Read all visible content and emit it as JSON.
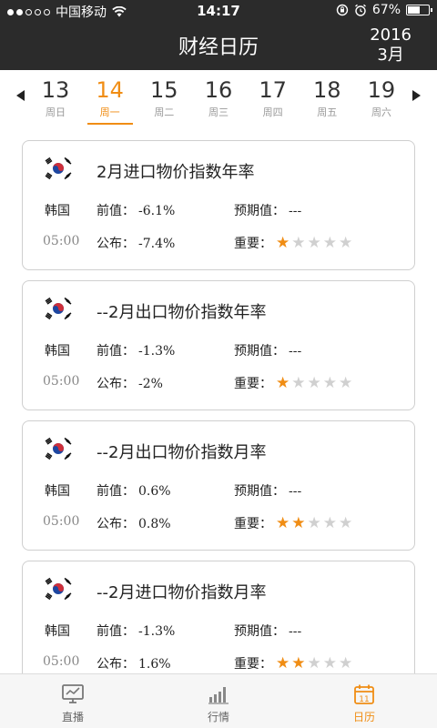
{
  "status": {
    "carrier": "中国移动",
    "time": "14:17",
    "battery": "67%",
    "battery_level": 0.67
  },
  "header": {
    "title": "财经日历",
    "year": "2016",
    "month": "3月"
  },
  "colors": {
    "accent": "#f08d14",
    "topbar": "#2b2b2b"
  },
  "days": [
    {
      "num": "13",
      "weekday": "周日",
      "active": false
    },
    {
      "num": "14",
      "weekday": "周一",
      "active": true
    },
    {
      "num": "15",
      "weekday": "周二",
      "active": false
    },
    {
      "num": "16",
      "weekday": "周三",
      "active": false
    },
    {
      "num": "17",
      "weekday": "周四",
      "active": false
    },
    {
      "num": "18",
      "weekday": "周五",
      "active": false
    },
    {
      "num": "19",
      "weekday": "周六",
      "active": false
    }
  ],
  "labels": {
    "previous": "前值：",
    "forecast": "预期值：",
    "published": "公布：",
    "importance": "重要："
  },
  "events": [
    {
      "flag_icon": "south-korea-flag-icon",
      "title": "2月进口物价指数年率",
      "country": "韩国",
      "time": "05:00",
      "previous": "-6.1%",
      "forecast": "---",
      "published": "-7.4%",
      "importance": 1
    },
    {
      "flag_icon": "south-korea-flag-icon",
      "title": "--2月出口物价指数年率",
      "country": "韩国",
      "time": "05:00",
      "previous": "-1.3%",
      "forecast": "---",
      "published": "-2%",
      "importance": 1
    },
    {
      "flag_icon": "south-korea-flag-icon",
      "title": "--2月出口物价指数月率",
      "country": "韩国",
      "time": "05:00",
      "previous": "0.6%",
      "forecast": "---",
      "published": "0.8%",
      "importance": 2
    },
    {
      "flag_icon": "south-korea-flag-icon",
      "title": "--2月进口物价指数月率",
      "country": "韩国",
      "time": "05:00",
      "previous": "-1.3%",
      "forecast": "---",
      "published": "1.6%",
      "importance": 2
    }
  ],
  "nav": {
    "tabs": [
      {
        "label": "直播",
        "icon": "monitor-icon",
        "active": false
      },
      {
        "label": "行情",
        "icon": "bar-chart-icon",
        "active": false
      },
      {
        "label": "日历",
        "icon": "calendar-icon",
        "active": true,
        "icon_text": "11"
      }
    ]
  }
}
